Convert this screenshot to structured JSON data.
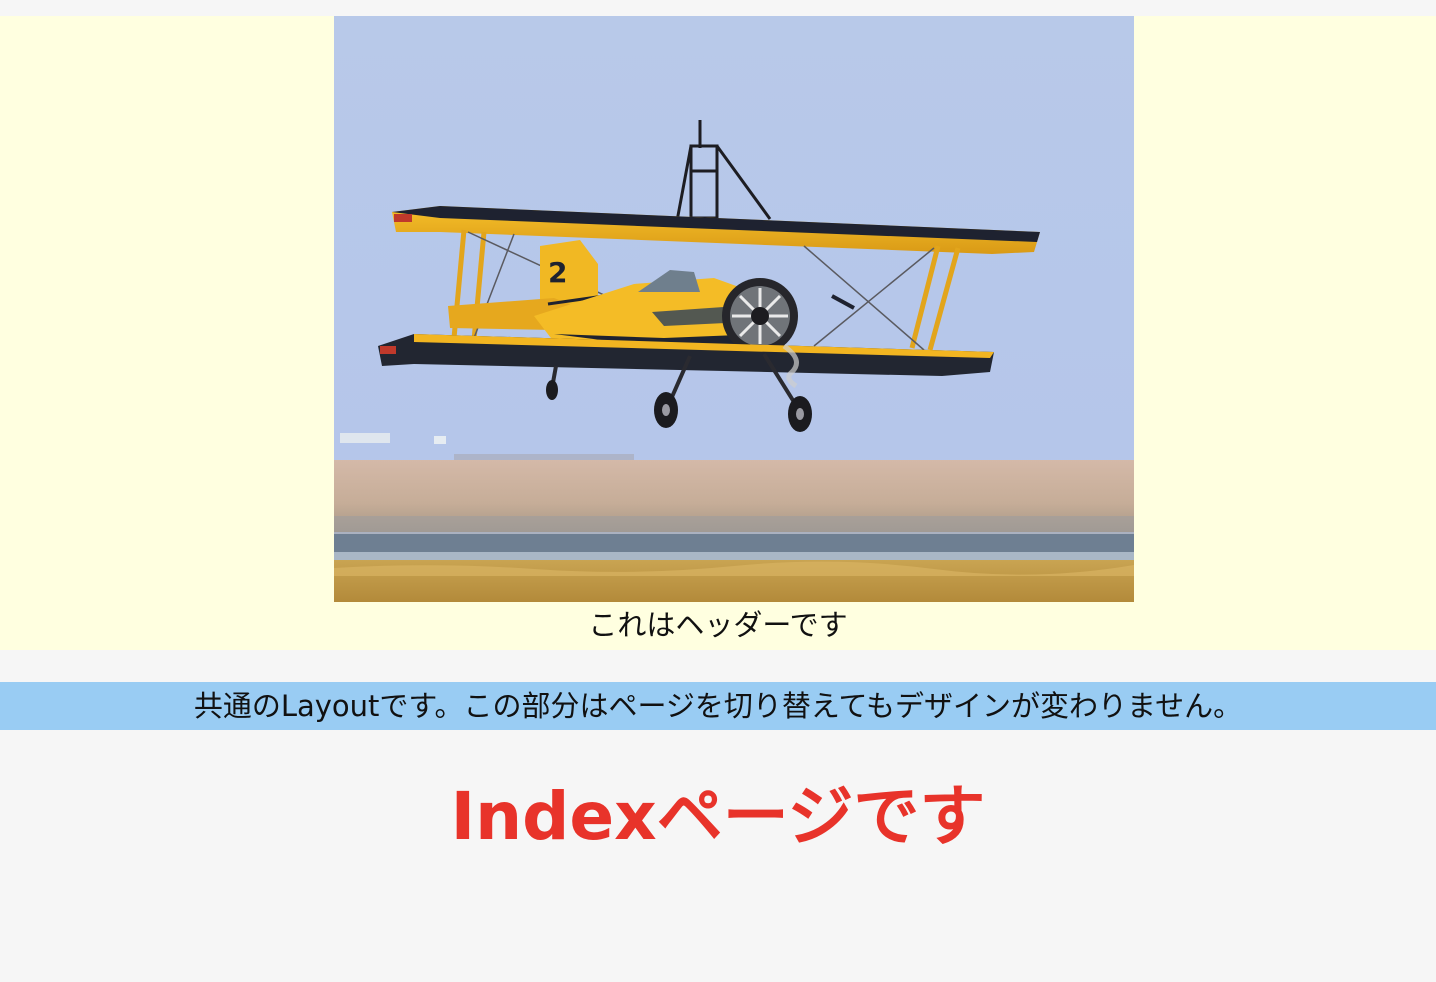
{
  "header": {
    "image_name": "biplane-photo",
    "caption": "これはヘッダーです"
  },
  "layout": {
    "banner": "共通のLayoutです。この部分はページを切り替えてもデザインが変わりません。"
  },
  "main": {
    "title": "Indexページです"
  },
  "colors": {
    "page_bg": "#f6f6f6",
    "header_bg": "#ffffe0",
    "banner_bg": "#99ccf3",
    "title": "#e8332a"
  }
}
